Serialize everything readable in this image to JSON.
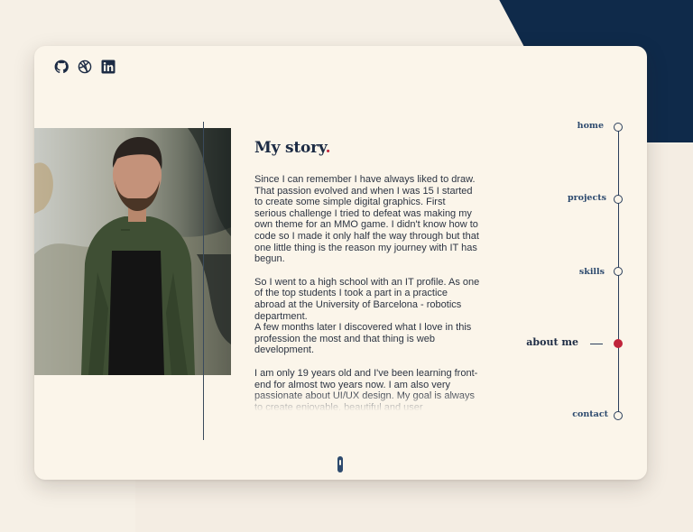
{
  "socials": {
    "github_icon": "github-icon",
    "dribbble_icon": "dribbble-icon",
    "linkedin_icon": "linkedin-icon"
  },
  "story": {
    "title": "My story",
    "title_dot": ".",
    "paragraphs": [
      "Since I can remember  I have always liked to draw. That passion evolved and when I was 15 I started to create some simple digital graphics. First serious challenge I tried to defeat was making my own theme for an MMO game.  I didn't know how to code so I made it only half the way through but that one little thing is the reason my journey with IT has begun.",
      "So I went to a high school with an IT profile. As one of the top students I took a part in a practice abroad at the University of Barcelona - robotics department.\nA few months later I discovered what I love in this profession the most and that thing is web development.",
      "I am only 19 years old and I've been learning front-end for almost two years now. I am also very passionate about UI/UX design. My goal is always to create enjoyable, beautiful and user"
    ]
  },
  "nav": {
    "items": [
      {
        "label": "home",
        "active": false
      },
      {
        "label": "projects",
        "active": false
      },
      {
        "label": "skills",
        "active": false
      },
      {
        "label": "about me",
        "active": true
      },
      {
        "label": "contact",
        "active": false
      }
    ]
  },
  "colors": {
    "accent": "#c0243b",
    "navy": "#0f2a4a",
    "text": "#1c2b44",
    "background": "#fbf5ea"
  }
}
